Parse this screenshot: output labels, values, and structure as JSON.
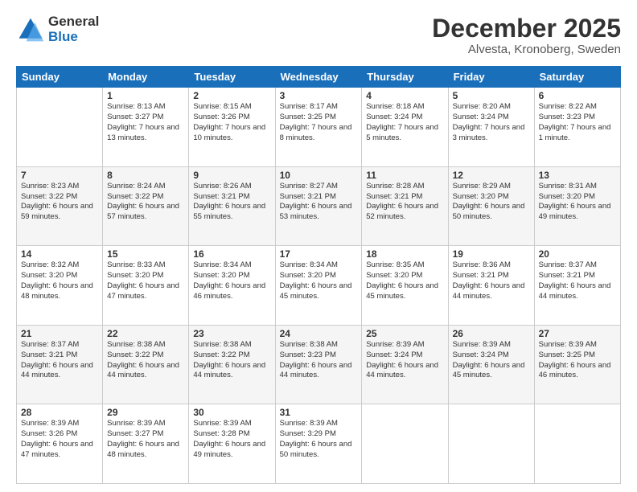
{
  "logo": {
    "general": "General",
    "blue": "Blue"
  },
  "title": "December 2025",
  "subtitle": "Alvesta, Kronoberg, Sweden",
  "days_header": [
    "Sunday",
    "Monday",
    "Tuesday",
    "Wednesday",
    "Thursday",
    "Friday",
    "Saturday"
  ],
  "weeks": [
    [
      {
        "day": "",
        "info": ""
      },
      {
        "day": "1",
        "info": "Sunrise: 8:13 AM\nSunset: 3:27 PM\nDaylight: 7 hours\nand 13 minutes."
      },
      {
        "day": "2",
        "info": "Sunrise: 8:15 AM\nSunset: 3:26 PM\nDaylight: 7 hours\nand 10 minutes."
      },
      {
        "day": "3",
        "info": "Sunrise: 8:17 AM\nSunset: 3:25 PM\nDaylight: 7 hours\nand 8 minutes."
      },
      {
        "day": "4",
        "info": "Sunrise: 8:18 AM\nSunset: 3:24 PM\nDaylight: 7 hours\nand 5 minutes."
      },
      {
        "day": "5",
        "info": "Sunrise: 8:20 AM\nSunset: 3:24 PM\nDaylight: 7 hours\nand 3 minutes."
      },
      {
        "day": "6",
        "info": "Sunrise: 8:22 AM\nSunset: 3:23 PM\nDaylight: 7 hours\nand 1 minute."
      }
    ],
    [
      {
        "day": "7",
        "info": "Sunrise: 8:23 AM\nSunset: 3:22 PM\nDaylight: 6 hours\nand 59 minutes."
      },
      {
        "day": "8",
        "info": "Sunrise: 8:24 AM\nSunset: 3:22 PM\nDaylight: 6 hours\nand 57 minutes."
      },
      {
        "day": "9",
        "info": "Sunrise: 8:26 AM\nSunset: 3:21 PM\nDaylight: 6 hours\nand 55 minutes."
      },
      {
        "day": "10",
        "info": "Sunrise: 8:27 AM\nSunset: 3:21 PM\nDaylight: 6 hours\nand 53 minutes."
      },
      {
        "day": "11",
        "info": "Sunrise: 8:28 AM\nSunset: 3:21 PM\nDaylight: 6 hours\nand 52 minutes."
      },
      {
        "day": "12",
        "info": "Sunrise: 8:29 AM\nSunset: 3:20 PM\nDaylight: 6 hours\nand 50 minutes."
      },
      {
        "day": "13",
        "info": "Sunrise: 8:31 AM\nSunset: 3:20 PM\nDaylight: 6 hours\nand 49 minutes."
      }
    ],
    [
      {
        "day": "14",
        "info": "Sunrise: 8:32 AM\nSunset: 3:20 PM\nDaylight: 6 hours\nand 48 minutes."
      },
      {
        "day": "15",
        "info": "Sunrise: 8:33 AM\nSunset: 3:20 PM\nDaylight: 6 hours\nand 47 minutes."
      },
      {
        "day": "16",
        "info": "Sunrise: 8:34 AM\nSunset: 3:20 PM\nDaylight: 6 hours\nand 46 minutes."
      },
      {
        "day": "17",
        "info": "Sunrise: 8:34 AM\nSunset: 3:20 PM\nDaylight: 6 hours\nand 45 minutes."
      },
      {
        "day": "18",
        "info": "Sunrise: 8:35 AM\nSunset: 3:20 PM\nDaylight: 6 hours\nand 45 minutes."
      },
      {
        "day": "19",
        "info": "Sunrise: 8:36 AM\nSunset: 3:21 PM\nDaylight: 6 hours\nand 44 minutes."
      },
      {
        "day": "20",
        "info": "Sunrise: 8:37 AM\nSunset: 3:21 PM\nDaylight: 6 hours\nand 44 minutes."
      }
    ],
    [
      {
        "day": "21",
        "info": "Sunrise: 8:37 AM\nSunset: 3:21 PM\nDaylight: 6 hours\nand 44 minutes."
      },
      {
        "day": "22",
        "info": "Sunrise: 8:38 AM\nSunset: 3:22 PM\nDaylight: 6 hours\nand 44 minutes."
      },
      {
        "day": "23",
        "info": "Sunrise: 8:38 AM\nSunset: 3:22 PM\nDaylight: 6 hours\nand 44 minutes."
      },
      {
        "day": "24",
        "info": "Sunrise: 8:38 AM\nSunset: 3:23 PM\nDaylight: 6 hours\nand 44 minutes."
      },
      {
        "day": "25",
        "info": "Sunrise: 8:39 AM\nSunset: 3:24 PM\nDaylight: 6 hours\nand 44 minutes."
      },
      {
        "day": "26",
        "info": "Sunrise: 8:39 AM\nSunset: 3:24 PM\nDaylight: 6 hours\nand 45 minutes."
      },
      {
        "day": "27",
        "info": "Sunrise: 8:39 AM\nSunset: 3:25 PM\nDaylight: 6 hours\nand 46 minutes."
      }
    ],
    [
      {
        "day": "28",
        "info": "Sunrise: 8:39 AM\nSunset: 3:26 PM\nDaylight: 6 hours\nand 47 minutes."
      },
      {
        "day": "29",
        "info": "Sunrise: 8:39 AM\nSunset: 3:27 PM\nDaylight: 6 hours\nand 48 minutes."
      },
      {
        "day": "30",
        "info": "Sunrise: 8:39 AM\nSunset: 3:28 PM\nDaylight: 6 hours\nand 49 minutes."
      },
      {
        "day": "31",
        "info": "Sunrise: 8:39 AM\nSunset: 3:29 PM\nDaylight: 6 hours\nand 50 minutes."
      },
      {
        "day": "",
        "info": ""
      },
      {
        "day": "",
        "info": ""
      },
      {
        "day": "",
        "info": ""
      }
    ]
  ]
}
